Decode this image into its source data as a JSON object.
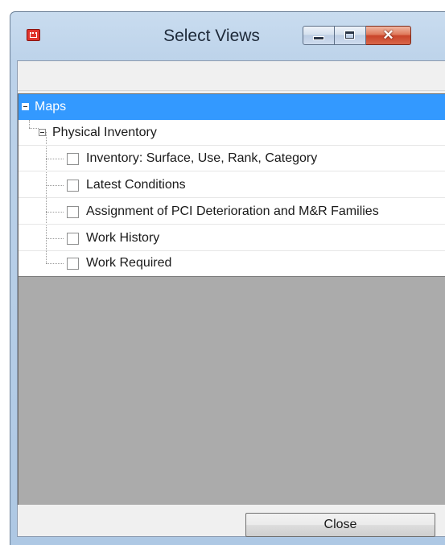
{
  "window": {
    "title": "Select Views",
    "close_glyph": "✕"
  },
  "tree": {
    "root": {
      "label": "Maps",
      "expanded": true,
      "selected": true
    },
    "group": {
      "label": "Physical Inventory",
      "expanded": true
    },
    "items": [
      {
        "label": "Inventory: Surface, Use, Rank, Category",
        "checked": false
      },
      {
        "label": "Latest Conditions",
        "checked": false
      },
      {
        "label": "Assignment of PCI Deterioration and M&R Families",
        "checked": false
      },
      {
        "label": "Work History",
        "checked": false
      },
      {
        "label": "Work Required",
        "checked": false
      }
    ]
  },
  "footer": {
    "close_label": "Close"
  },
  "colors": {
    "selection": "#3399ff",
    "empty_area": "#ababab",
    "window_frame": "#bdd3ea"
  }
}
